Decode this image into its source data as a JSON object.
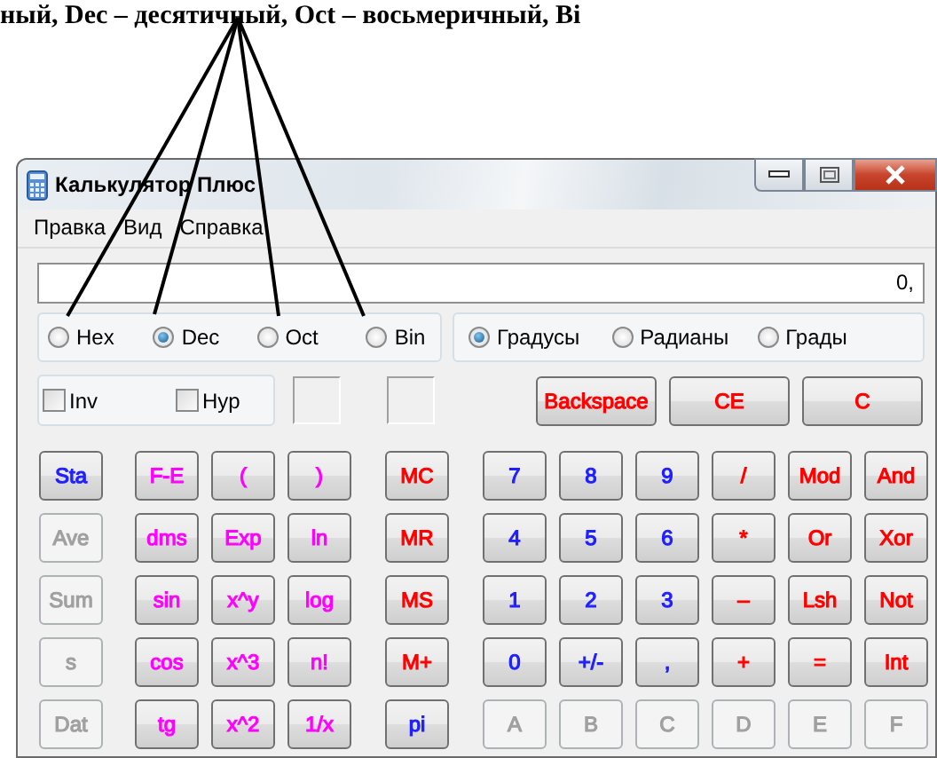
{
  "document_text": "ный, Dec – десятичный, Oct – восьмеричный, Bi",
  "window": {
    "title": "Калькулятор Плюс"
  },
  "menu": [
    "Правка",
    "Вид",
    "Справка"
  ],
  "display": {
    "value": "0,"
  },
  "number_system": [
    {
      "label": "Hex",
      "selected": false
    },
    {
      "label": "Dec",
      "selected": true
    },
    {
      "label": "Oct",
      "selected": false
    },
    {
      "label": "Bin",
      "selected": false
    }
  ],
  "angle_units": [
    {
      "label": "Градусы",
      "selected": true
    },
    {
      "label": "Радианы",
      "selected": false
    },
    {
      "label": "Грады",
      "selected": false
    }
  ],
  "toggles": [
    {
      "label": "Inv",
      "checked": false
    },
    {
      "label": "Hyp",
      "checked": false
    }
  ],
  "edit_buttons": [
    {
      "label": "Backspace",
      "color": "#ff0000"
    },
    {
      "label": "CE",
      "color": "#ff0000"
    },
    {
      "label": "C",
      "color": "#ff0000"
    }
  ],
  "keypad_rows": [
    [
      {
        "label": "Sta",
        "color": "#2020ff",
        "disabled": false
      },
      {
        "label": "F-E",
        "color": "#ff00ff",
        "disabled": false
      },
      {
        "label": "(",
        "color": "#ff00ff",
        "disabled": false
      },
      {
        "label": ")",
        "color": "#ff00ff",
        "disabled": false
      },
      {
        "label": "MC",
        "color": "#ff0000",
        "disabled": false
      },
      {
        "label": "7",
        "color": "#2020ff",
        "disabled": false
      },
      {
        "label": "8",
        "color": "#2020ff",
        "disabled": false
      },
      {
        "label": "9",
        "color": "#2020ff",
        "disabled": false
      },
      {
        "label": "/",
        "color": "#ff0000",
        "disabled": false
      },
      {
        "label": "Mod",
        "color": "#ff0000",
        "disabled": false
      },
      {
        "label": "And",
        "color": "#ff0000",
        "disabled": false
      }
    ],
    [
      {
        "label": "Ave",
        "disabled": true
      },
      {
        "label": "dms",
        "color": "#ff00ff",
        "disabled": false
      },
      {
        "label": "Exp",
        "color": "#ff00ff",
        "disabled": false
      },
      {
        "label": "ln",
        "color": "#ff00ff",
        "disabled": false
      },
      {
        "label": "MR",
        "color": "#ff0000",
        "disabled": false
      },
      {
        "label": "4",
        "color": "#2020ff",
        "disabled": false
      },
      {
        "label": "5",
        "color": "#2020ff",
        "disabled": false
      },
      {
        "label": "6",
        "color": "#2020ff",
        "disabled": false
      },
      {
        "label": "*",
        "color": "#ff0000",
        "disabled": false
      },
      {
        "label": "Or",
        "color": "#ff0000",
        "disabled": false
      },
      {
        "label": "Xor",
        "color": "#ff0000",
        "disabled": false
      }
    ],
    [
      {
        "label": "Sum",
        "disabled": true
      },
      {
        "label": "sin",
        "color": "#ff00ff",
        "disabled": false
      },
      {
        "label": "x^y",
        "color": "#ff00ff",
        "disabled": false
      },
      {
        "label": "log",
        "color": "#ff00ff",
        "disabled": false
      },
      {
        "label": "MS",
        "color": "#ff0000",
        "disabled": false
      },
      {
        "label": "1",
        "color": "#2020ff",
        "disabled": false
      },
      {
        "label": "2",
        "color": "#2020ff",
        "disabled": false
      },
      {
        "label": "3",
        "color": "#2020ff",
        "disabled": false
      },
      {
        "label": "–",
        "color": "#ff0000",
        "disabled": false
      },
      {
        "label": "Lsh",
        "color": "#ff0000",
        "disabled": false
      },
      {
        "label": "Not",
        "color": "#ff0000",
        "disabled": false
      }
    ],
    [
      {
        "label": "s",
        "disabled": true
      },
      {
        "label": "cos",
        "color": "#ff00ff",
        "disabled": false
      },
      {
        "label": "x^3",
        "color": "#ff00ff",
        "disabled": false
      },
      {
        "label": "n!",
        "color": "#ff00ff",
        "disabled": false
      },
      {
        "label": "M+",
        "color": "#ff0000",
        "disabled": false
      },
      {
        "label": "0",
        "color": "#2020ff",
        "disabled": false
      },
      {
        "label": "+/-",
        "color": "#2020ff",
        "disabled": false
      },
      {
        "label": ",",
        "color": "#2020ff",
        "disabled": false
      },
      {
        "label": "+",
        "color": "#ff0000",
        "disabled": false
      },
      {
        "label": "=",
        "color": "#ff0000",
        "disabled": false
      },
      {
        "label": "Int",
        "color": "#ff0000",
        "disabled": false
      }
    ],
    [
      {
        "label": "Dat",
        "disabled": true
      },
      {
        "label": "tg",
        "color": "#ff00ff",
        "disabled": false
      },
      {
        "label": "x^2",
        "color": "#ff00ff",
        "disabled": false
      },
      {
        "label": "1/x",
        "color": "#ff00ff",
        "disabled": false
      },
      {
        "label": "pi",
        "color": "#2020ff",
        "disabled": false
      },
      {
        "label": "A",
        "disabled": true
      },
      {
        "label": "B",
        "disabled": true
      },
      {
        "label": "C",
        "disabled": true
      },
      {
        "label": "D",
        "disabled": true
      },
      {
        "label": "E",
        "disabled": true
      },
      {
        "label": "F",
        "disabled": true
      }
    ]
  ]
}
